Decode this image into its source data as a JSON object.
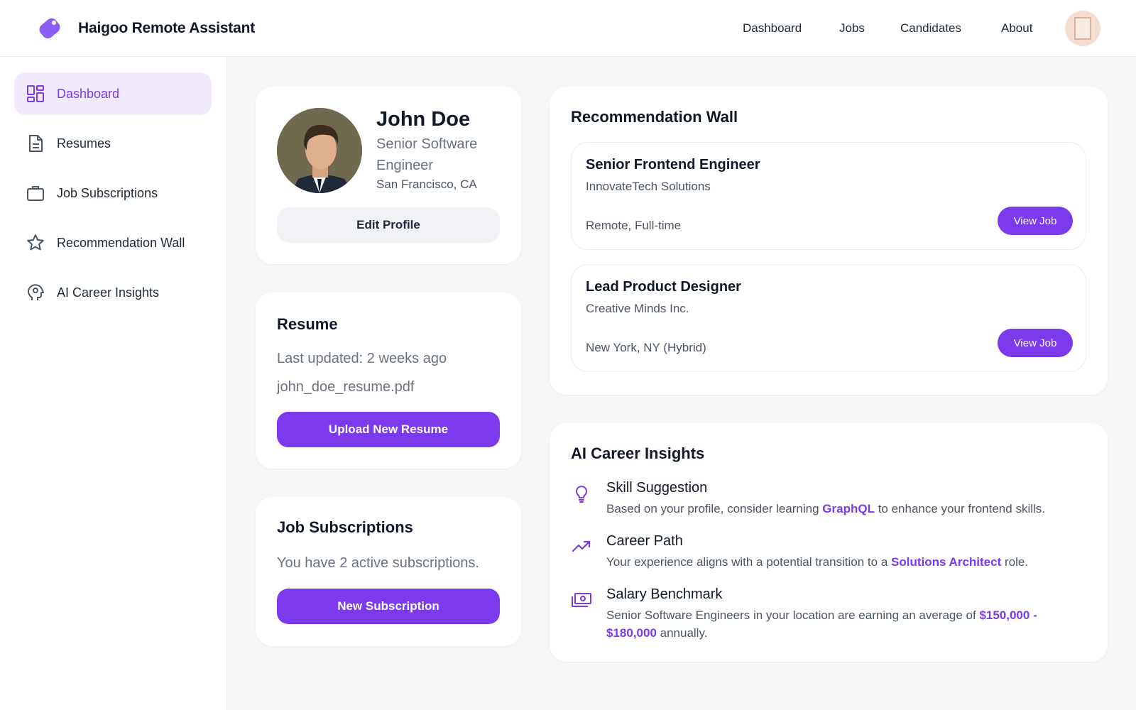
{
  "app": {
    "title": "Haigoo Remote Assistant",
    "accent_color": "#7c3aed"
  },
  "topnav": {
    "items": [
      {
        "label": "Dashboard"
      },
      {
        "label": "Jobs"
      },
      {
        "label": "Candidates"
      },
      {
        "label": "About"
      }
    ],
    "avatar_icon": "user-avatar"
  },
  "sidebar": {
    "items": [
      {
        "label": "Dashboard",
        "icon": "dashboard-icon",
        "active": true
      },
      {
        "label": "Resumes",
        "icon": "document-icon",
        "active": false
      },
      {
        "label": "Job Subscriptions",
        "icon": "briefcase-icon",
        "active": false
      },
      {
        "label": "Recommendation Wall",
        "icon": "star-icon",
        "active": false
      },
      {
        "label": "AI Career Insights",
        "icon": "head-gear-icon",
        "active": false
      }
    ]
  },
  "profile": {
    "name": "John Doe",
    "title": "Senior Software Engineer",
    "location": "San Francisco, CA",
    "edit_label": "Edit Profile"
  },
  "resume": {
    "heading": "Resume",
    "last_updated": "Last updated: 2 weeks ago",
    "filename": "john_doe_resume.pdf",
    "upload_label": "Upload New Resume"
  },
  "subscriptions": {
    "heading": "Job Subscriptions",
    "text": "You have 2 active subscriptions.",
    "button_label": "New Subscription"
  },
  "recommendations": {
    "heading": "Recommendation Wall",
    "jobs": [
      {
        "title": "Senior Frontend Engineer",
        "company": "InnovateTech Solutions",
        "meta": "Remote, Full-time",
        "button": "View Job"
      },
      {
        "title": "Lead Product Designer",
        "company": "Creative Minds Inc.",
        "meta": "New York, NY (Hybrid)",
        "button": "View Job"
      }
    ]
  },
  "insights": {
    "heading": "AI Career Insights",
    "items": [
      {
        "icon": "lightbulb-icon",
        "title": "Skill Suggestion",
        "before": "Based on your profile, consider learning ",
        "highlight": "GraphQL",
        "after": " to enhance your frontend skills."
      },
      {
        "icon": "trending-up-icon",
        "title": "Career Path",
        "before": "Your experience aligns with a potential transition to a ",
        "highlight": "Solutions Architect",
        "after": " role."
      },
      {
        "icon": "money-icon",
        "title": "Salary Benchmark",
        "before": "Senior Software Engineers in your location are earning an average of ",
        "highlight": "$150,000 - $180,000",
        "after": " annually."
      }
    ]
  }
}
